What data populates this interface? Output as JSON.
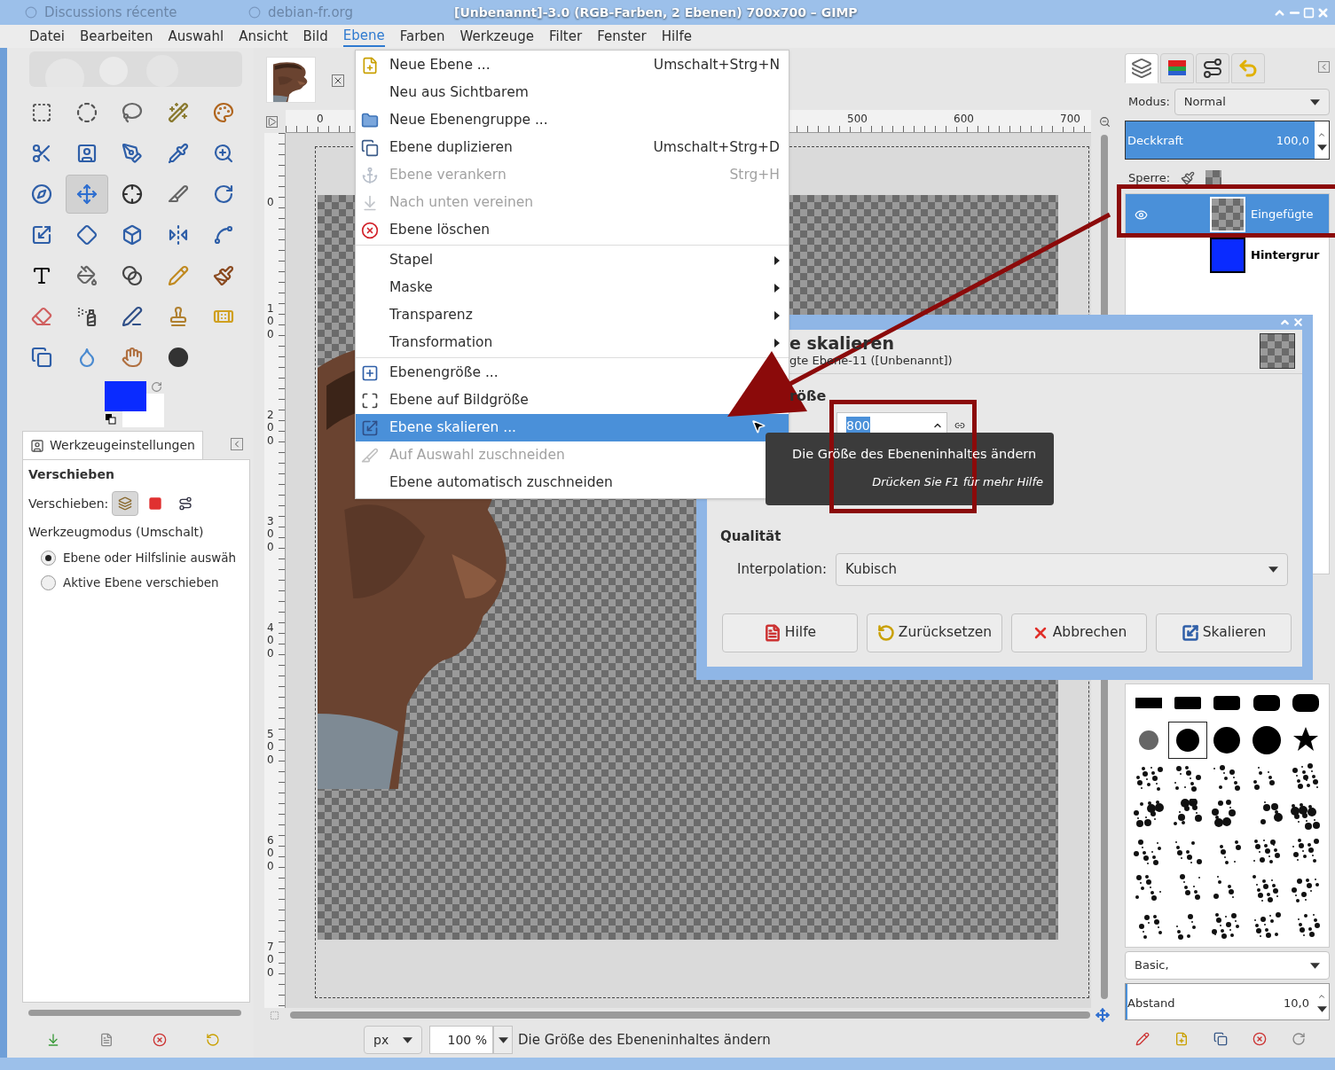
{
  "browser_tabs": [
    {
      "label": "Discussions récente"
    },
    {
      "label": "debian-fr.org"
    }
  ],
  "window": {
    "title": "[Unbenannt]-3.0 (RGB-Farben, 2 Ebenen) 700x700 – GIMP"
  },
  "menubar": [
    {
      "label": "Datei",
      "selected": false
    },
    {
      "label": "Bearbeiten",
      "selected": false
    },
    {
      "label": "Auswahl",
      "selected": false
    },
    {
      "label": "Ansicht",
      "selected": false
    },
    {
      "label": "Bild",
      "selected": false
    },
    {
      "label": "Ebene",
      "selected": true
    },
    {
      "label": "Farben",
      "selected": false
    },
    {
      "label": "Werkzeuge",
      "selected": false
    },
    {
      "label": "Filter",
      "selected": false
    },
    {
      "label": "Fenster",
      "selected": false
    },
    {
      "label": "Hilfe",
      "selected": false
    }
  ],
  "toolbox": {
    "tools": [
      {
        "kind": "rect-select",
        "selected": false
      },
      {
        "kind": "ellipse-select",
        "selected": false
      },
      {
        "kind": "free-select",
        "selected": false
      },
      {
        "kind": "fuzzy-select",
        "selected": false
      },
      {
        "kind": "color-select",
        "selected": false
      },
      {
        "kind": "scissors",
        "selected": false
      },
      {
        "kind": "foreground-select",
        "selected": false
      },
      {
        "kind": "paths",
        "selected": false
      },
      {
        "kind": "color-picker",
        "selected": false
      },
      {
        "kind": "zoom",
        "selected": false
      },
      {
        "kind": "measure",
        "selected": false
      },
      {
        "kind": "move",
        "selected": true
      },
      {
        "kind": "align",
        "selected": false
      },
      {
        "kind": "crop",
        "selected": false
      },
      {
        "kind": "rotate",
        "selected": false
      },
      {
        "kind": "scale",
        "selected": false
      },
      {
        "kind": "shear",
        "selected": false
      },
      {
        "kind": "perspective",
        "selected": false
      },
      {
        "kind": "flip",
        "selected": false
      },
      {
        "kind": "cage",
        "selected": false
      },
      {
        "kind": "text",
        "selected": false
      },
      {
        "kind": "bucket",
        "selected": false
      },
      {
        "kind": "gradient",
        "selected": false
      },
      {
        "kind": "pencil",
        "selected": false
      },
      {
        "kind": "paintbrush",
        "selected": false
      },
      {
        "kind": "eraser",
        "selected": false
      },
      {
        "kind": "airbrush",
        "selected": false
      },
      {
        "kind": "ink",
        "selected": false
      },
      {
        "kind": "clone",
        "selected": false
      },
      {
        "kind": "heal",
        "selected": false
      },
      {
        "kind": "perspective-clone",
        "selected": false
      },
      {
        "kind": "blur",
        "selected": false
      },
      {
        "kind": "smudge",
        "selected": false
      },
      {
        "kind": "dodge",
        "selected": false
      }
    ]
  },
  "tool_options": {
    "tab": "Werkzeugeinstellungen",
    "title": "Verschieben",
    "move_label": "Verschieben:",
    "move_modes": [
      {
        "kind": "layer",
        "selected": true
      },
      {
        "kind": "selection",
        "selected": false
      },
      {
        "kind": "path",
        "selected": false
      }
    ],
    "mode_label": "Werkzeugmodus (Umschalt)",
    "radios": [
      {
        "label": "Ebene oder Hilfslinie auswäh",
        "selected": true
      },
      {
        "label": "Aktive Ebene verschieben",
        "selected": false
      }
    ]
  },
  "canvas": {
    "h_ruler": [
      "0",
      "500",
      "600",
      "700"
    ],
    "v_ruler": [
      "0",
      "100",
      "200",
      "300",
      "400",
      "500",
      "600",
      "700"
    ]
  },
  "layer_menu": {
    "groups": [
      [
        {
          "label": "Neue Ebene ...",
          "shortcut": "Umschalt+Strg+N",
          "kind": "new",
          "disabled": false,
          "selected": false,
          "submenu": false
        },
        {
          "label": "Neu aus Sichtbarem",
          "kind": "plain",
          "disabled": false,
          "selected": false,
          "submenu": false
        },
        {
          "label": "Neue Ebenengruppe ...",
          "kind": "group",
          "disabled": false,
          "selected": false,
          "submenu": false
        },
        {
          "label": "Ebene duplizieren",
          "shortcut": "Umschalt+Strg+D",
          "kind": "duplicate",
          "disabled": false,
          "selected": false,
          "submenu": false
        },
        {
          "label": "Ebene verankern",
          "shortcut": "Strg+H",
          "kind": "anchor",
          "disabled": true,
          "selected": false,
          "submenu": false
        },
        {
          "label": "Nach unten vereinen",
          "kind": "merge",
          "disabled": true,
          "selected": false,
          "submenu": false
        },
        {
          "label": "Ebene löschen",
          "kind": "delete",
          "disabled": false,
          "selected": false,
          "submenu": false
        }
      ],
      [
        {
          "label": "Stapel",
          "kind": "plain",
          "disabled": false,
          "selected": false,
          "submenu": true
        },
        {
          "label": "Maske",
          "kind": "plain",
          "disabled": false,
          "selected": false,
          "submenu": true
        },
        {
          "label": "Transparenz",
          "kind": "plain",
          "disabled": false,
          "selected": false,
          "submenu": true
        },
        {
          "label": "Transformation",
          "kind": "plain",
          "disabled": false,
          "selected": false,
          "submenu": true
        }
      ],
      [
        {
          "label": "Ebenengröße ...",
          "kind": "size",
          "disabled": false,
          "selected": false
        },
        {
          "label": "Ebene auf Bildgröße",
          "kind": "fit",
          "disabled": false,
          "selected": false
        },
        {
          "label": "Ebene skalieren ...",
          "kind": "scale",
          "disabled": false,
          "selected": true,
          "submenu": false
        },
        {
          "label": "Auf Auswahl zuschneiden",
          "kind": "crop",
          "disabled": true,
          "selected": false,
          "submenu": false
        },
        {
          "label": "Ebene automatisch zuschneiden",
          "kind": "plain",
          "disabled": false,
          "selected": false
        }
      ]
    ]
  },
  "dialog": {
    "title": "e skalieren",
    "subtitle": "gte Ebene-11 ([Unbenannt])",
    "section": "röße",
    "width_value": "800",
    "quality_heading": "Qualität",
    "interpolation_label": "Interpolation:",
    "interpolation": "Kubisch",
    "buttons": [
      {
        "label": "Hilfe",
        "kind": "help"
      },
      {
        "label": "Zurücksetzen",
        "kind": "reset"
      },
      {
        "label": "Abbrechen",
        "kind": "cancel"
      },
      {
        "label": "Skalieren",
        "kind": "scale"
      }
    ]
  },
  "tooltip": {
    "text": "Die Größe des Ebeneninhaltes ändern",
    "hint": "Drücken Sie F1 für mehr Hilfe"
  },
  "layers_panel": {
    "tabs": [
      {
        "kind": "layers",
        "selected": true
      },
      {
        "kind": "channels",
        "selected": false
      },
      {
        "kind": "paths",
        "selected": false
      },
      {
        "kind": "undo",
        "selected": false
      }
    ],
    "mode_label": "Modus:",
    "mode": "Normal",
    "opacity": {
      "label": "Deckkraft",
      "value": "100,0",
      "level": 1
    },
    "lock_label": "Sperre:",
    "layers": [
      {
        "name": "Eingefügte",
        "kind": "transparent",
        "selected": true,
        "visible": true
      },
      {
        "name": "Hintergrur",
        "kind": "fill",
        "selected": false,
        "visible": false
      }
    ]
  },
  "brushes_panel": {
    "brushes": [
      {
        "selected": false
      },
      {
        "selected": false
      },
      {
        "selected": false
      },
      {
        "selected": false
      },
      {
        "selected": false
      },
      {
        "selected": false
      },
      {
        "selected": true
      },
      {
        "selected": false
      },
      {
        "selected": false
      },
      {
        "selected": false
      },
      {
        "selected": false
      },
      {
        "selected": false
      },
      {
        "selected": false
      },
      {
        "selected": false
      },
      {
        "selected": false
      },
      {
        "selected": false
      },
      {
        "selected": false
      },
      {
        "selected": false
      },
      {
        "selected": false
      },
      {
        "selected": false
      },
      {
        "selected": false
      },
      {
        "selected": false
      },
      {
        "selected": false
      },
      {
        "selected": false
      },
      {
        "selected": false
      },
      {
        "selected": false
      },
      {
        "selected": false
      },
      {
        "selected": false
      },
      {
        "selected": false
      },
      {
        "selected": false
      },
      {
        "selected": false
      },
      {
        "selected": false
      },
      {
        "selected": false
      },
      {
        "selected": false
      },
      {
        "selected": false
      }
    ],
    "preset": "Basic,",
    "spacing": {
      "label": "Abstand",
      "value": "10,0",
      "level": 0.01
    }
  },
  "status_bar": {
    "unit": "px",
    "zoom": "100 %",
    "message": "Die Größe des Ebeneninhaltes ändern"
  }
}
